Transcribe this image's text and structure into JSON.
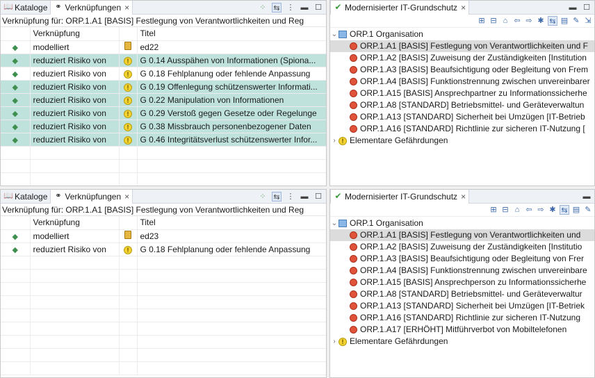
{
  "left_tabs": {
    "kataloge": "Kataloge",
    "verknuepfungen": "Verknüpfungen",
    "close": "×"
  },
  "right_tab": {
    "title": "Modernisierter IT-Grundschutz",
    "close": "×"
  },
  "top_left": {
    "header": "Verknüpfung für: ORP.1.A1 [BASIS] Festlegung von Verantwortlichkeiten und Reg",
    "columns": [
      "Verknüpfung",
      "Titel"
    ],
    "rows": [
      {
        "type": "modelliert",
        "title": "ed22",
        "icon": "book-icon"
      },
      {
        "type": "reduziert Risiko von",
        "title": "G 0.14 Ausspähen von Informationen (Spiona...",
        "icon": "warning-icon"
      },
      {
        "type": "reduziert Risiko von",
        "title": "G 0.18 Fehlplanung oder fehlende Anpassung",
        "icon": "warning-icon"
      },
      {
        "type": "reduziert Risiko von",
        "title": "G 0.19 Offenlegung schützenswerter Informati...",
        "icon": "warning-icon"
      },
      {
        "type": "reduziert Risiko von",
        "title": "G 0.22 Manipulation von Informationen",
        "icon": "warning-icon"
      },
      {
        "type": "reduziert Risiko von",
        "title": "G 0.29 Verstoß gegen Gesetze oder Regelunge",
        "icon": "warning-icon"
      },
      {
        "type": "reduziert Risiko von",
        "title": "G 0.38 Missbrauch personenbezogener Daten",
        "icon": "warning-icon"
      },
      {
        "type": "reduziert Risiko von",
        "title": "G 0.46 Integritätsverlust schützenswerter Infor...",
        "icon": "warning-icon"
      }
    ]
  },
  "bottom_left": {
    "header": "Verknüpfung für: ORP.1.A1 [BASIS] Festlegung von Verantwortlichkeiten und Reg",
    "columns": [
      "Verknüpfung",
      "Titel"
    ],
    "rows": [
      {
        "type": "modelliert",
        "title": "ed23",
        "icon": "book-icon"
      },
      {
        "type": "reduziert Risiko von",
        "title": "G 0.18 Fehlplanung oder fehlende Anpassung",
        "icon": "warning-icon"
      }
    ]
  },
  "top_right": {
    "root": "ORP.1 Organisation",
    "items": [
      "ORP.1.A1 [BASIS] Festlegung von Verantwortlichkeiten und F",
      "ORP.1.A2 [BASIS] Zuweisung der Zuständigkeiten [Institution",
      "ORP.1.A3 [BASIS] Beaufsichtigung oder Begleitung von Frem",
      "ORP.1.A4 [BASIS] Funktionstrennung zwischen unvereinbarer",
      "ORP.1.A15 [BASIS] Ansprechpartner zu Informationssicherhe",
      "ORP.1.A8 [STANDARD] Betriebsmittel- und Geräteverwaltun",
      "ORP.1.A13 [STANDARD] Sicherheit bei Umzügen [IT-Betrieb",
      "ORP.1.A16 [STANDARD] Richtlinie zur sicheren IT-Nutzung ["
    ],
    "other": "Elementare Gefährdungen"
  },
  "bottom_right": {
    "root": "ORP.1 Organisation",
    "items": [
      "ORP.1.A1 [BASIS] Festlegung von Verantwortlichkeiten und",
      "ORP.1.A2 [BASIS] Zuweisung der Zuständigkeiten [Institutio",
      "ORP.1.A3 [BASIS] Beaufsichtigung oder Begleitung von Frer",
      "ORP.1.A4 [BASIS] Funktionstrennung zwischen unvereinbare",
      "ORP.1.A15 [BASIS] Ansprechperson zu Informationssicherhe",
      "ORP.1.A8 [STANDARD] Betriebsmittel- und Geräteverwaltur",
      "ORP.1.A13 [STANDARD] Sicherheit bei Umzügen [IT-Betriek",
      "ORP.1.A16 [STANDARD] Richtlinie zur sicheren IT-Nutzung",
      "ORP.1.A17 [ERHÖHT] Mitführverbot von Mobiltelefonen"
    ],
    "other": "Elementare Gefährdungen"
  },
  "colors": {
    "highlight_row": "#bfe3dc",
    "selected_tree_row": "#dcdcdc",
    "threat_icon": "#e0523a"
  }
}
